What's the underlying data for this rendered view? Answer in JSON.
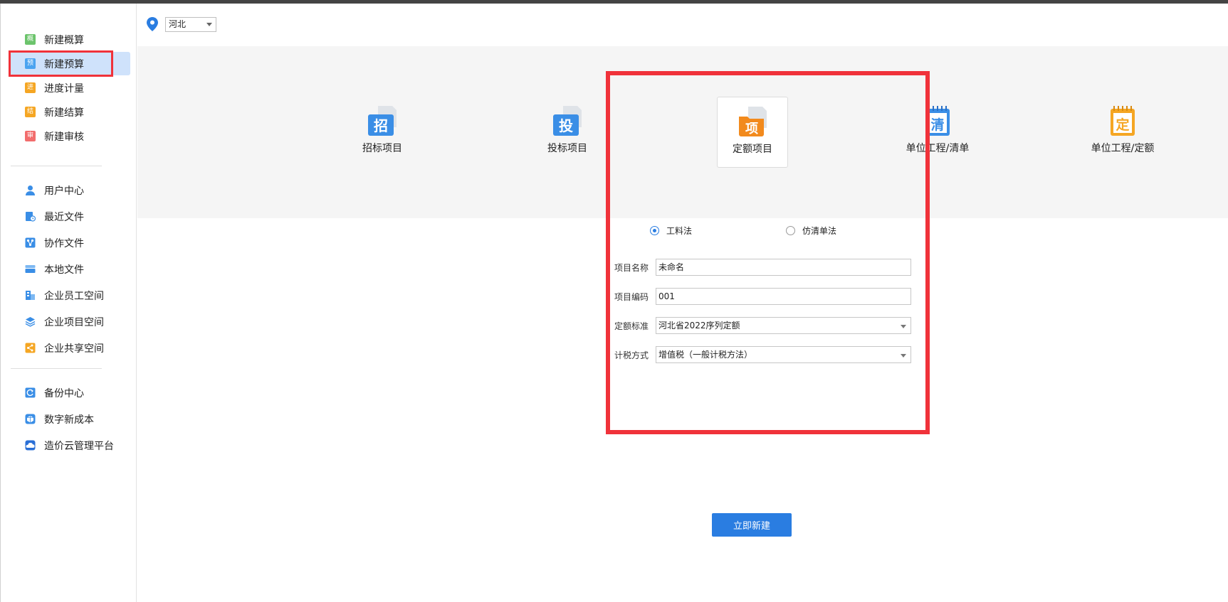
{
  "sidebar": {
    "items": [
      {
        "label": "新建概算",
        "icon": "estimate-icon",
        "glyph": "概",
        "color": "#6cc46c"
      },
      {
        "label": "新建预算",
        "icon": "budget-icon",
        "glyph": "预",
        "color": "#4aa3f0"
      },
      {
        "label": "进度计量",
        "icon": "progress-icon",
        "glyph": "进",
        "color": "#f5a623"
      },
      {
        "label": "新建结算",
        "icon": "settlement-icon",
        "glyph": "结",
        "color": "#f5a623"
      },
      {
        "label": "新建审核",
        "icon": "audit-icon",
        "glyph": "审",
        "color": "#f26d6d"
      },
      {
        "label": "用户中心",
        "icon": "user-icon",
        "glyph": "",
        "color": "#3a8ee6"
      },
      {
        "label": "最近文件",
        "icon": "recent-file-icon",
        "glyph": "",
        "color": "#3a8ee6"
      },
      {
        "label": "协作文件",
        "icon": "collab-file-icon",
        "glyph": "",
        "color": "#3a8ee6"
      },
      {
        "label": "本地文件",
        "icon": "local-file-icon",
        "glyph": "",
        "color": "#3a8ee6"
      },
      {
        "label": "企业员工空间",
        "icon": "staff-space-icon",
        "glyph": "",
        "color": "#3a8ee6"
      },
      {
        "label": "企业项目空间",
        "icon": "project-space-icon",
        "glyph": "",
        "color": "#3a8ee6"
      },
      {
        "label": "企业共享空间",
        "icon": "share-space-icon",
        "glyph": "",
        "color": "#f5a623"
      },
      {
        "label": "备份中心",
        "icon": "backup-icon",
        "glyph": "",
        "color": "#3a8ee6"
      },
      {
        "label": "数字新成本",
        "icon": "digital-cost-icon",
        "glyph": "",
        "color": "#3a8ee6"
      },
      {
        "label": "造价云管理平台",
        "icon": "cloud-platform-icon",
        "glyph": "",
        "color": "#3a8ee6"
      }
    ],
    "active_index": 1
  },
  "region": {
    "value": "河北"
  },
  "project_types": [
    {
      "label": "招标项目",
      "glyph": "招",
      "color": "#3a8ee6"
    },
    {
      "label": "投标项目",
      "glyph": "投",
      "color": "#3a8ee6"
    },
    {
      "label": "定额项目",
      "glyph": "项",
      "color": "#f28a1d"
    },
    {
      "label": "单位工程/清单",
      "glyph": "清",
      "color": "#3a8ee6"
    },
    {
      "label": "单位工程/定额",
      "glyph": "定",
      "color": "#f5a623"
    }
  ],
  "selected_project_type": "定额项目",
  "method": {
    "options": [
      "工料法",
      "仿清单法"
    ],
    "selected": "工料法"
  },
  "form": {
    "name_label": "项目名称",
    "name_value": "未命名",
    "code_label": "项目编码",
    "code_value": "001",
    "standard_label": "定额标准",
    "standard_value": "河北省2022序列定额",
    "tax_label": "计税方式",
    "tax_value": "增值税（一般计税方法）"
  },
  "create_button": "立即新建",
  "colors": {
    "accent": "#2a7de1",
    "highlight": "#f0323a",
    "active_bg": "#cfe2fb"
  }
}
